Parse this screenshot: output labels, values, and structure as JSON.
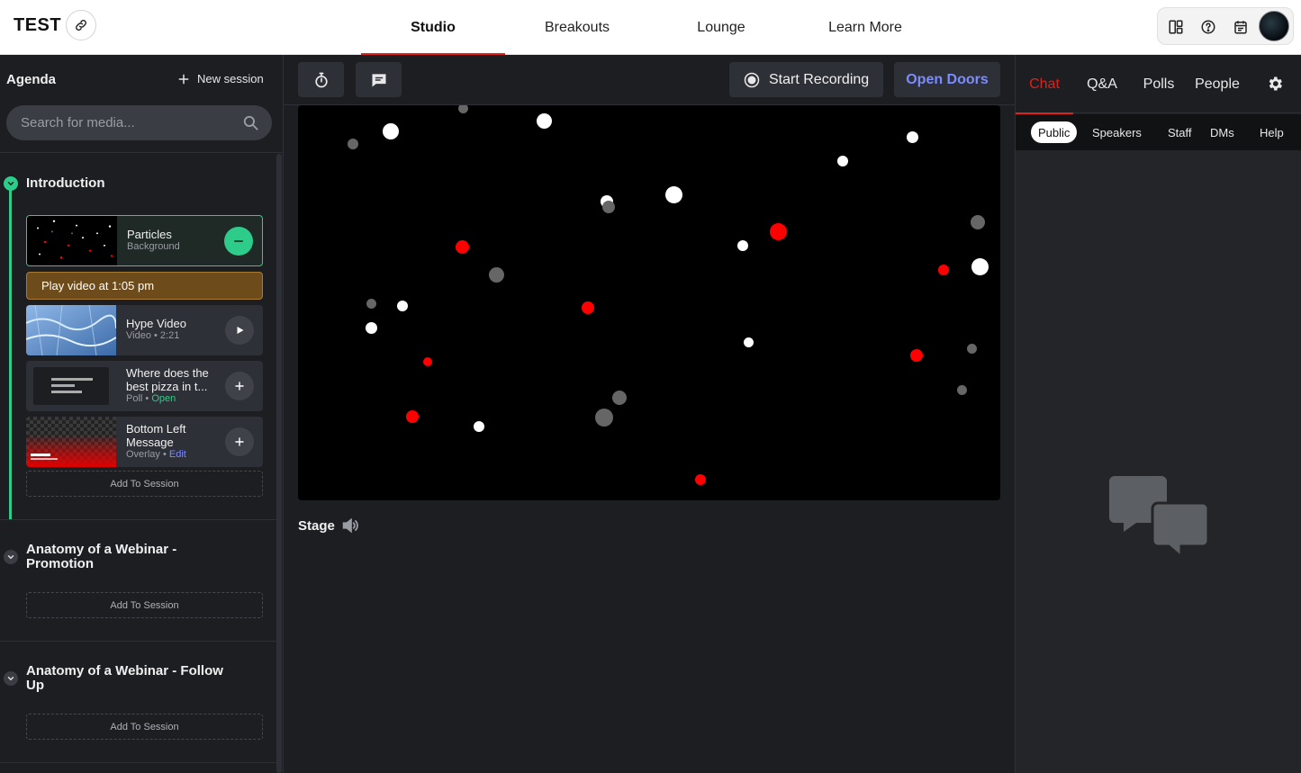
{
  "app": {
    "title": "TEST"
  },
  "nav": {
    "tabs": [
      {
        "label": "Studio",
        "active": true
      },
      {
        "label": "Breakouts",
        "active": false
      },
      {
        "label": "Lounge",
        "active": false
      },
      {
        "label": "Learn More",
        "active": false
      }
    ]
  },
  "header_tools": [
    "layout-icon",
    "help-icon",
    "calendar-icon",
    "user-avatar"
  ],
  "sidebar": {
    "title": "Agenda",
    "new_session_label": "New session",
    "search_placeholder": "Search for media...",
    "sections": [
      {
        "title": "Introduction",
        "expanded": true,
        "items": [
          {
            "title": "Particles",
            "type": "Background",
            "action": "remove",
            "selected": true
          },
          {
            "banner": "Play video at 1:05 pm"
          },
          {
            "title": "Hype Video",
            "type": "Video",
            "duration": "2:21",
            "action": "play"
          },
          {
            "title": "Where does the best pizza in t...",
            "title_full_line1": "Where does the",
            "title_line2": "best pizza in t...",
            "type": "Poll",
            "status": "Open",
            "action": "add"
          },
          {
            "title_line1": "Bottom Left",
            "title_line2": "Message",
            "type": "Overlay",
            "link": "Edit",
            "action": "add"
          }
        ],
        "add_label": "Add To Session"
      },
      {
        "title_line1": "Anatomy of a Webinar -",
        "title_line2": "Promotion",
        "expanded": false,
        "add_label": "Add To Session"
      },
      {
        "title_line1": "Anatomy of a Webinar - Follow",
        "title_line2": "Up",
        "expanded": false,
        "add_label": "Add To Session"
      }
    ],
    "bullet_separator": "•"
  },
  "studio": {
    "start_recording_label": "Start Recording",
    "open_doors_label": "Open Doors",
    "stage_label": "Stage"
  },
  "right_panel": {
    "tabs": [
      {
        "label": "Chat",
        "active": true
      },
      {
        "label": "Q&A",
        "active": false
      },
      {
        "label": "Polls",
        "active": false
      },
      {
        "label": "People",
        "active": false
      }
    ],
    "subtabs": [
      {
        "label": "Public",
        "active": true
      },
      {
        "label": "Speakers",
        "active": false
      },
      {
        "label": "Staff",
        "active": false
      },
      {
        "label": "DMs",
        "active": false
      },
      {
        "label": "Help",
        "active": false
      }
    ]
  },
  "colors": {
    "accent_red": "#e0221c",
    "accent_green": "#2ecc8a",
    "accent_blue": "#7c8cff",
    "banner_brown": "#6e4b1a"
  }
}
